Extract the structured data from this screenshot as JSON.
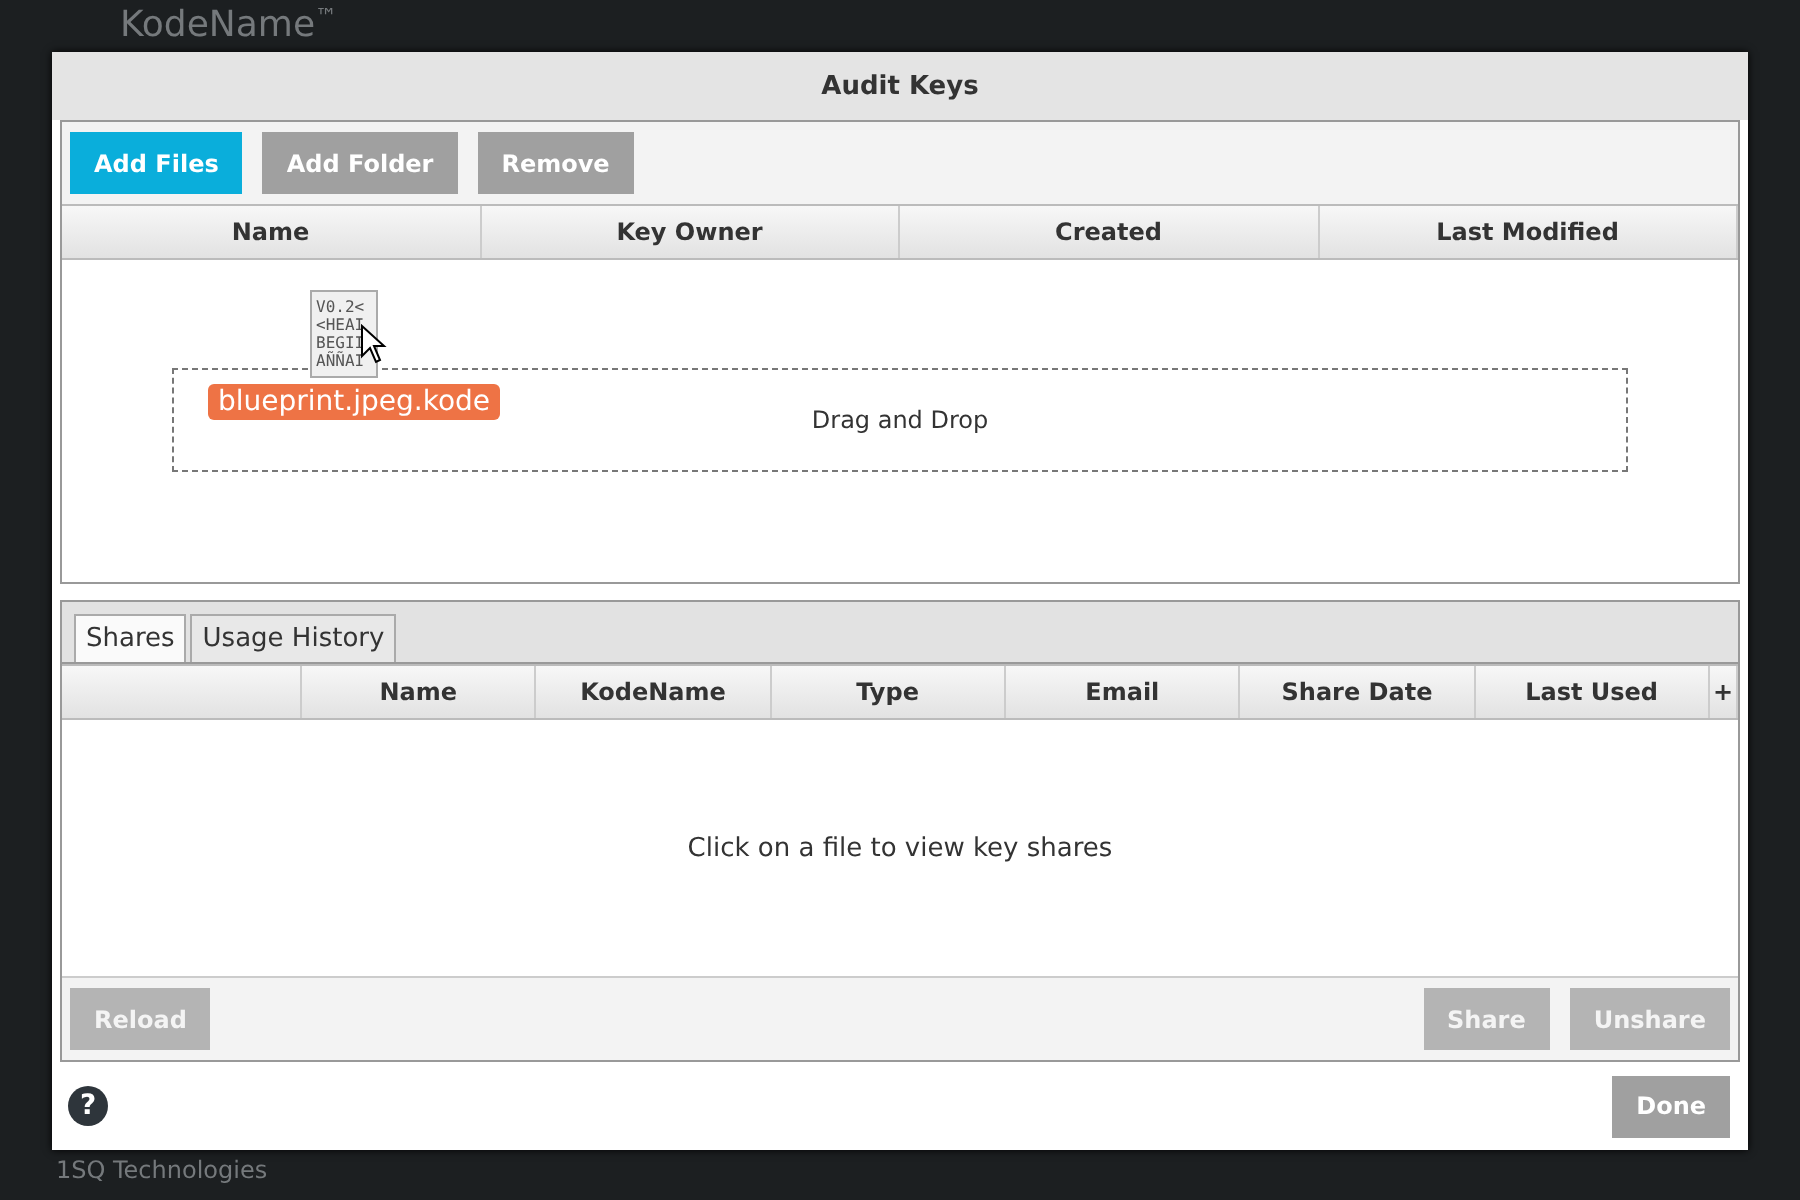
{
  "background_app": {
    "brand": "KodeName",
    "trademark": "™",
    "footer": "1SQ Technologies"
  },
  "dialog": {
    "title": "Audit Keys",
    "toolbar": [
      {
        "label": "Add Files",
        "primary": true
      },
      {
        "label": "Add Folder",
        "primary": false
      },
      {
        "label": "Remove",
        "primary": false
      }
    ],
    "keys_table": {
      "columns": [
        "Name",
        "Key Owner",
        "Created",
        "Last Modified"
      ],
      "drop_zone": "Drag and Drop",
      "dragged_file": {
        "preview_lines": [
          "V0.2<",
          "<HEAI",
          "BEGII",
          "AÑÑAI"
        ],
        "label": "blueprint.jpeg.kode"
      }
    },
    "tabs": [
      {
        "label": "Shares",
        "selected": true
      },
      {
        "label": "Usage History",
        "selected": false
      }
    ],
    "shares_table": {
      "columns": [
        "",
        "Name",
        "KodeName",
        "Type",
        "Email",
        "Share Date",
        "Last Used"
      ],
      "add_column": "+",
      "empty_message": "Click on a file to view key shares"
    },
    "left_buttons": [
      {
        "label": "Reload",
        "disabled": true
      }
    ],
    "right_buttons": [
      {
        "label": "Share",
        "disabled": true
      },
      {
        "label": "Unshare",
        "disabled": true
      }
    ],
    "help": "?",
    "done": {
      "label": "Done",
      "disabled": false
    }
  }
}
